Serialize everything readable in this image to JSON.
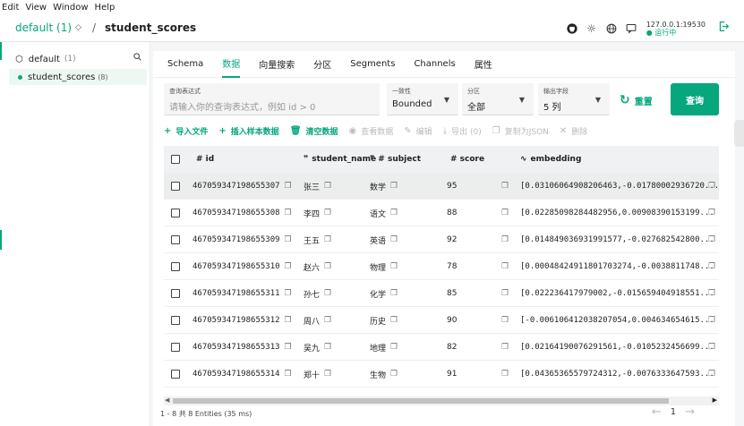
{
  "menu": [
    "Edit",
    "View",
    "Window",
    "Help"
  ],
  "header": {
    "database": "default (1)",
    "separator": "/",
    "collection": "student_scores",
    "server_address": "127.0.0.1:19530",
    "server_status": "● 运行中"
  },
  "sidebar": {
    "db_name": "default",
    "db_count": "(1)",
    "collection_name": "student_scores",
    "collection_count": "(8)"
  },
  "tabs": [
    "Schema",
    "数据",
    "向量搜索",
    "分区",
    "Segments",
    "Channels",
    "属性"
  ],
  "active_tab": 1,
  "query": {
    "expr_label": "查询表达式",
    "expr_placeholder": "请输入你的查询表达式，例如 id > 0",
    "consistency_label": "一致性",
    "consistency_value": "Bounded",
    "partition_label": "分区",
    "partition_value": "全部",
    "output_label": "输出字段",
    "output_value": "5 列",
    "reset_label": "重置",
    "query_label": "查询"
  },
  "actions": [
    {
      "label": "导入文件",
      "enabled": true,
      "icon": "+"
    },
    {
      "label": "插入样本数据",
      "enabled": true,
      "icon": "+"
    },
    {
      "label": "清空数据",
      "enabled": true,
      "icon": "🗑"
    },
    {
      "label": "查看数据",
      "enabled": false,
      "icon": "◉"
    },
    {
      "label": "编辑",
      "enabled": false,
      "icon": "✎"
    },
    {
      "label": "导出 (0)",
      "enabled": false,
      "icon": "⤓"
    },
    {
      "label": "复制为JSON",
      "enabled": false,
      "icon": "❐"
    },
    {
      "label": "删除",
      "enabled": false,
      "icon": "✕"
    }
  ],
  "table": {
    "columns": [
      "# id",
      "student_name",
      "# subject",
      "# score",
      "embedding"
    ],
    "column_icons": [
      "",
      "❞",
      "❞",
      "",
      "∿"
    ],
    "rows": [
      {
        "id": "467059347198655307",
        "name": "张三",
        "subject": "数学",
        "score": "95",
        "embedding": "[0.03106064908206463,-0.01780002936720..."
      },
      {
        "id": "467059347198655308",
        "name": "李四",
        "subject": "语文",
        "score": "88",
        "embedding": "[0.02285098284482956,0.00908390153199..."
      },
      {
        "id": "467059347198655309",
        "name": "王五",
        "subject": "英语",
        "score": "92",
        "embedding": "[0.014849036931991577,-0.027682542800..."
      },
      {
        "id": "467059347198655310",
        "name": "赵六",
        "subject": "物理",
        "score": "78",
        "embedding": "[0.00048424911801703274,-0.0038811748..."
      },
      {
        "id": "467059347198655311",
        "name": "孙七",
        "subject": "化学",
        "score": "85",
        "embedding": "[0.022236417979002,-0.015659404918551..."
      },
      {
        "id": "467059347198655312",
        "name": "周八",
        "subject": "历史",
        "score": "90",
        "embedding": "[-0.006106412038207054,0.004634654615..."
      },
      {
        "id": "467059347198655313",
        "name": "吴九",
        "subject": "地理",
        "score": "82",
        "embedding": "[0.02164190076291561,-0.0105232456699..."
      },
      {
        "id": "467059347198655314",
        "name": "郑十",
        "subject": "生物",
        "score": "91",
        "embedding": "[0.04365365579724312,-0.0076333647593..."
      }
    ]
  },
  "footer": {
    "info": "1 - 8 共 8 Entities (35 ms)",
    "page": "1"
  }
}
